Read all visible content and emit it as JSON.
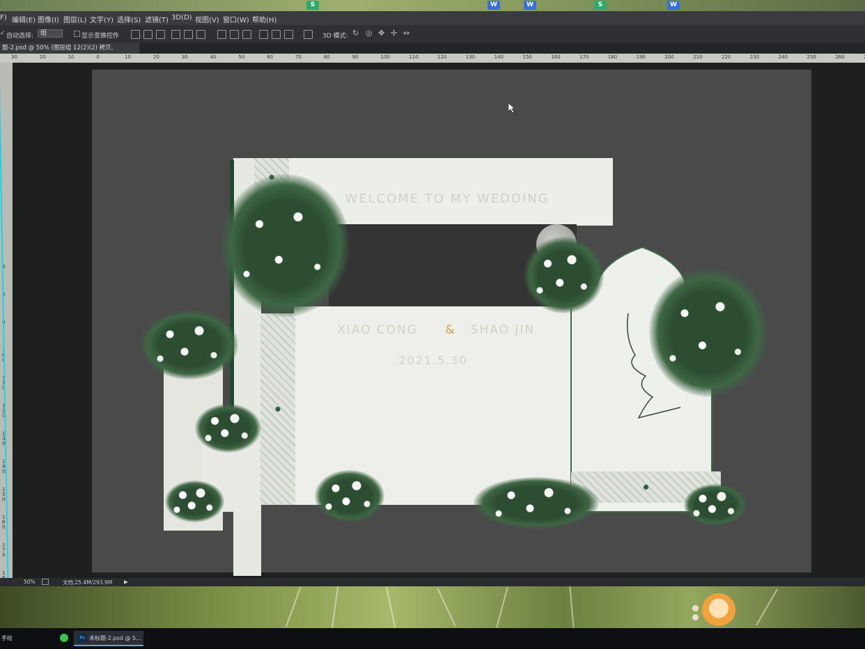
{
  "desktop_icons": [
    {
      "label": "S",
      "color": "#2ea86b"
    },
    {
      "label": "W",
      "color": "#3a6fd8"
    },
    {
      "label": "W",
      "color": "#3a6fd8"
    },
    {
      "label": "S",
      "color": "#2ea86b"
    },
    {
      "label": "W",
      "color": "#3a6fd8"
    }
  ],
  "menubar": {
    "items": [
      "F)",
      "编辑(E)",
      "图像(I)",
      "图层(L)",
      "文字(Y)",
      "选择(S)",
      "滤镜(T)",
      "3D(D)",
      "视图(V)",
      "窗口(W)",
      "帮助(H)"
    ]
  },
  "options_bar": {
    "auto_select_label": "自动选择:",
    "auto_select_value": "组",
    "show_transform_label": "显示变换控件",
    "mode_3d_label": "3D 模式:"
  },
  "document_tab": {
    "title": "题-2.psd @ 50% (图层组 12(2)(2) 拷贝, CMYK/8)",
    "close": "×"
  },
  "ruler": {
    "top_ticks": [
      "30",
      "20",
      "10",
      "0",
      "10",
      "20",
      "30",
      "40",
      "50",
      "60",
      "70",
      "80",
      "90",
      "100",
      "110",
      "120",
      "130",
      "140",
      "150",
      "160",
      "170",
      "180",
      "190",
      "200",
      "210",
      "220",
      "230",
      "240",
      "250",
      "260",
      "270"
    ],
    "left_ticks": [
      "3",
      "8",
      "9",
      "100",
      "110",
      "120",
      "130",
      "140",
      "150",
      "160",
      "170",
      "180"
    ]
  },
  "design": {
    "welcome": "WELCOME TO MY WEDDING",
    "names_left": "XIAO CONG",
    "ampersand": "&",
    "names_right": "SHAO JIN",
    "date": "2021.5.30"
  },
  "statusbar": {
    "zoom": "50%",
    "doc_info": "文档:25.4M/293.9M",
    "arrow": "▶"
  },
  "taskbar": {
    "left_label": "手绘",
    "app_label": "未标题-2.psd @ 5..."
  }
}
